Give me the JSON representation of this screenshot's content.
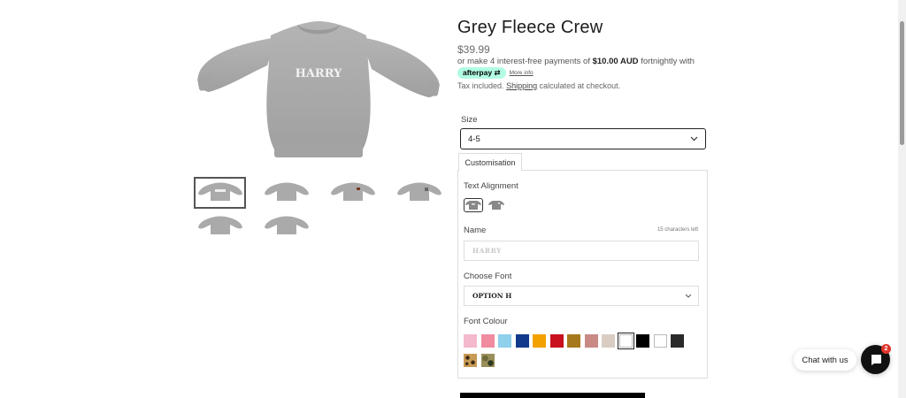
{
  "product": {
    "title": "Grey Fleece Crew",
    "price": "$39.99",
    "afterpay_prefix": "or make 4 interest-free payments of",
    "afterpay_amount": "$10.00 AUD",
    "afterpay_suffix": "fortnightly with",
    "afterpay_brand": "afterpay",
    "afterpay_more": "More info",
    "tax_prefix": "Tax included.",
    "tax_link": "Shipping",
    "tax_suffix": "calculated at checkout.",
    "print_text": "HARRY"
  },
  "gallery": {
    "thumb_count": 6,
    "active_index": 0
  },
  "size": {
    "label": "Size",
    "value": "4-5"
  },
  "customisation": {
    "tab_label": "Customisation",
    "text_alignment_label": "Text Alignment",
    "name_label": "Name",
    "chars_left": "15 characters left",
    "name_placeholder": "HARRY",
    "font_label": "Choose Font",
    "font_value": "OPTION H",
    "colour_label": "Font Colour",
    "colours": [
      "#f4b9cc",
      "#f08ba0",
      "#8fd0ec",
      "#123a8c",
      "#f3a100",
      "#c8101e",
      "#a67a1c",
      "#c98a86",
      "#d9cdc3",
      "#ffffff",
      "#000000",
      "#ffffff",
      "#2a2a2a",
      "leopard",
      "camo"
    ],
    "selected_colour_index": 9
  },
  "chat": {
    "label": "Chat with us",
    "badge": "2"
  },
  "colors": {
    "afterpay_mint": "#b2fce4",
    "sweater_grey": "#a9a9a9",
    "badge_red": "#e0352b"
  }
}
